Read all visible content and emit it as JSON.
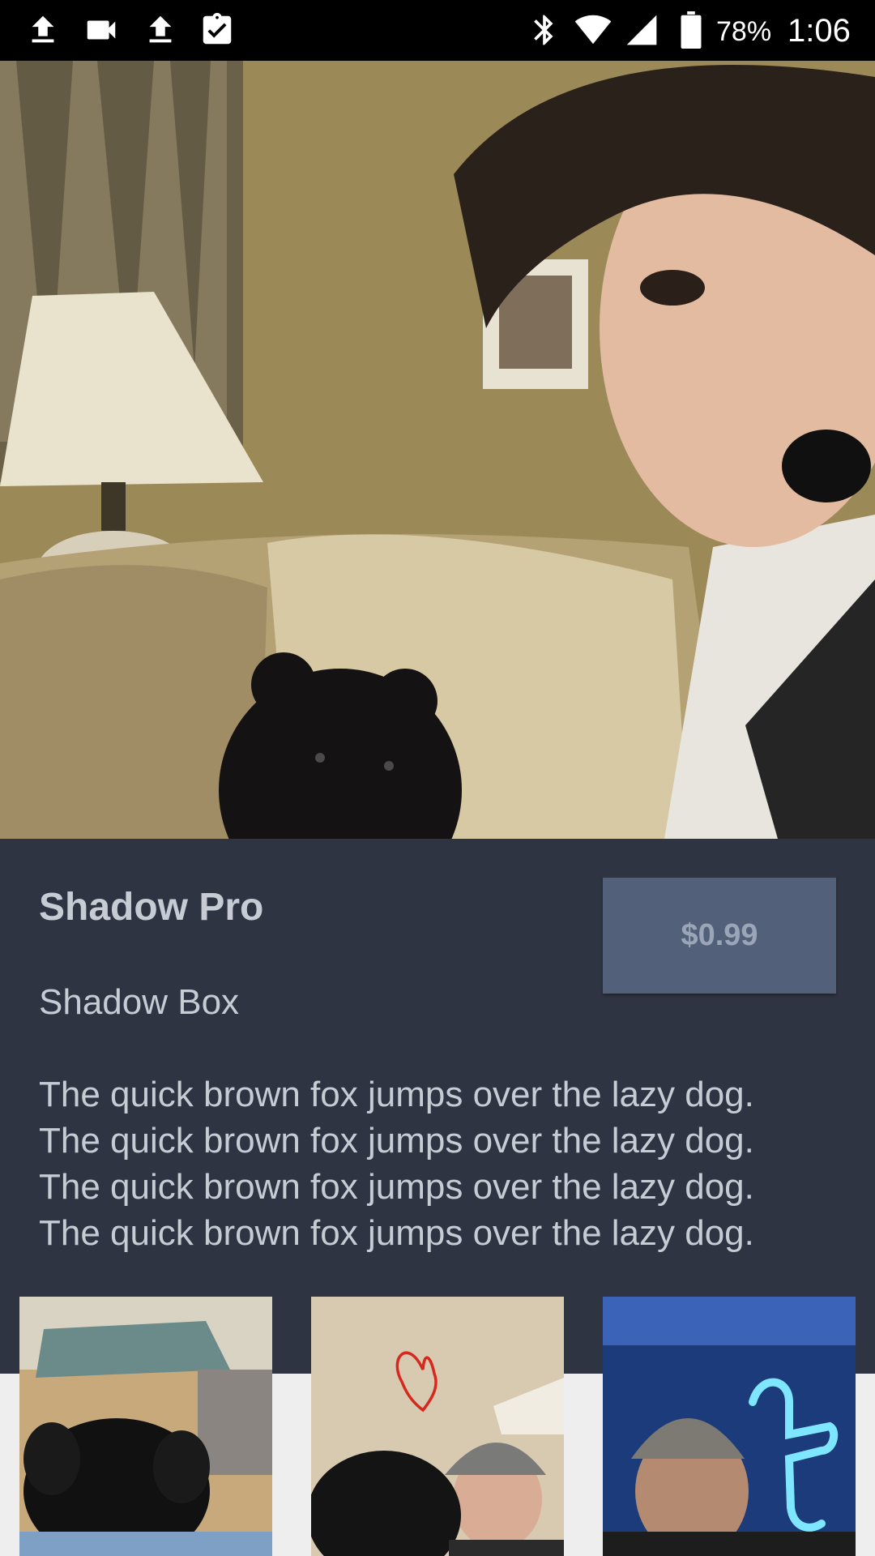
{
  "status_bar": {
    "icons": [
      "upload-icon",
      "videocam-icon",
      "upload-icon",
      "clipboard-check-icon",
      "bluetooth-icon",
      "wifi-icon",
      "signal-icon",
      "battery-icon"
    ],
    "battery": "78%",
    "time": "1:06"
  },
  "hero": {
    "image": "selfie with dog on couch"
  },
  "product": {
    "name": "Shadow Pro",
    "category": "Shadow Box",
    "price_label": "$0.99",
    "description": [
      "The quick brown fox jumps over the lazy dog.",
      "The quick brown fox jumps over the lazy dog.",
      "The quick brown fox jumps over the lazy dog.",
      "The quick brown fox jumps over the lazy dog."
    ]
  },
  "thumbnails": [
    {
      "image": "dog on wooden floor"
    },
    {
      "image": "man and dog with drawn heart"
    },
    {
      "image": "man with neon sign"
    }
  ],
  "colors": {
    "background": "#2f3442",
    "button": "#526079",
    "text": "#c6cbd4"
  }
}
